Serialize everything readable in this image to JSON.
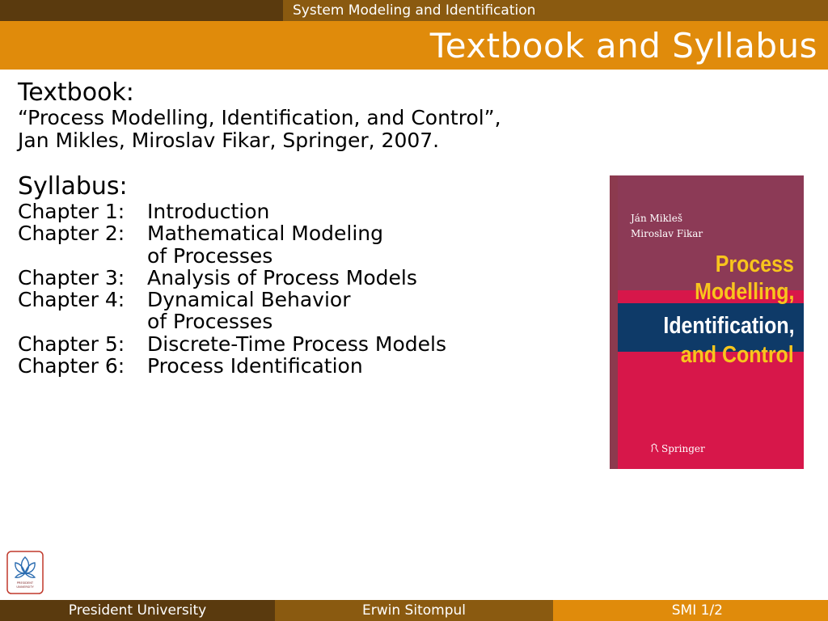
{
  "header": {
    "course_title": "System Modeling and Identification",
    "slide_title": "Textbook and Syllabus"
  },
  "content": {
    "textbook_heading": "Textbook:",
    "textbook_line1": "“Process Modelling, Identification, and Control”,",
    "textbook_line2": "Jan Mikles, Miroslav Fikar, Springer, 2007.",
    "syllabus_heading": "Syllabus:",
    "chapters": [
      {
        "label": "Chapter 1:",
        "title": "Introduction",
        "cont": ""
      },
      {
        "label": "Chapter 2:",
        "title": "Mathematical Modeling",
        "cont": "of Processes"
      },
      {
        "label": "Chapter 3:",
        "title": "Analysis of Process Models",
        "cont": ""
      },
      {
        "label": "Chapter 4:",
        "title": "Dynamical Behavior",
        "cont": "of Processes"
      },
      {
        "label": "Chapter 5:",
        "title": "Discrete-Time Process Models",
        "cont": ""
      },
      {
        "label": "Chapter 6:",
        "title": "Process Identification",
        "cont": ""
      }
    ]
  },
  "book_cover": {
    "author1": "Ján Mikleš",
    "author2": "Miroslav Fikar",
    "title_line1": "Process",
    "title_line2": "Modelling,",
    "title_line3": "Identification,",
    "title_line4": "and Control",
    "publisher": "Springer"
  },
  "logo": {
    "text_line1": "PRESIDENT",
    "text_line2": "UNIVERSITY"
  },
  "footer": {
    "institution": "President University",
    "author": "Erwin Sitompul",
    "page": "SMI 1/2"
  },
  "colors": {
    "header_dark": "#5a3a0e",
    "header_mid": "#8a5a10",
    "accent_orange": "#e08b0b",
    "cover_red": "#d7174a",
    "cover_navy": "#0e3a68",
    "cover_yellow": "#f7c51d"
  }
}
